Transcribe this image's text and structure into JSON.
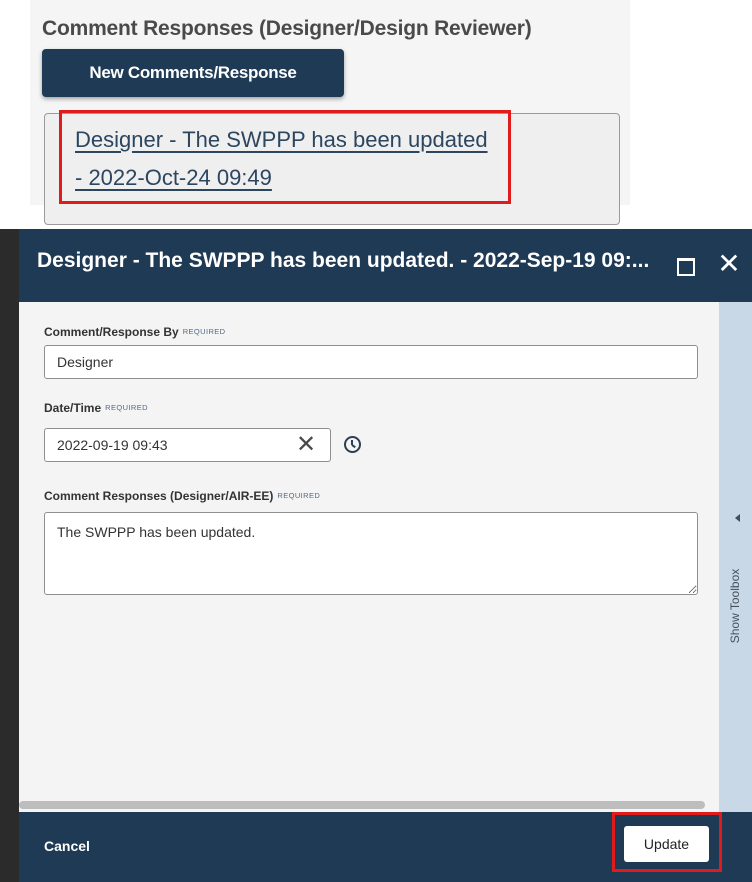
{
  "panel": {
    "section_title": "Comment Responses (Designer/Design Reviewer)",
    "new_button_label": "New Comments/Response",
    "entries": [
      {
        "link_text": "Designer - The SWPPP has been updated - 2022-Oct-24 09:49"
      }
    ]
  },
  "dialog": {
    "title": "Designer - The SWPPP has been updated. - 2022-Sep-19 09:...",
    "maximize_icon": "maximize-icon",
    "close_icon": "close-icon",
    "close_glyph": "✕",
    "required_text": "REQUIRED",
    "fields": {
      "by": {
        "label": "Comment/Response By",
        "value": "Designer"
      },
      "datetime": {
        "label": "Date/Time",
        "value": "2022-09-19 09:43",
        "clear_glyph": "✕"
      },
      "comment": {
        "label": "Comment Responses (Designer/AIR-EE)",
        "value": "The SWPPP has been updated."
      }
    },
    "toolbox_label": "Show Toolbox",
    "footer": {
      "cancel_label": "Cancel",
      "update_label": "Update"
    }
  },
  "colors": {
    "header_bg": "#1f3a55",
    "toolbox_bg": "#c9d8e7",
    "highlight": "#e01b1b",
    "link": "#2c4660"
  }
}
